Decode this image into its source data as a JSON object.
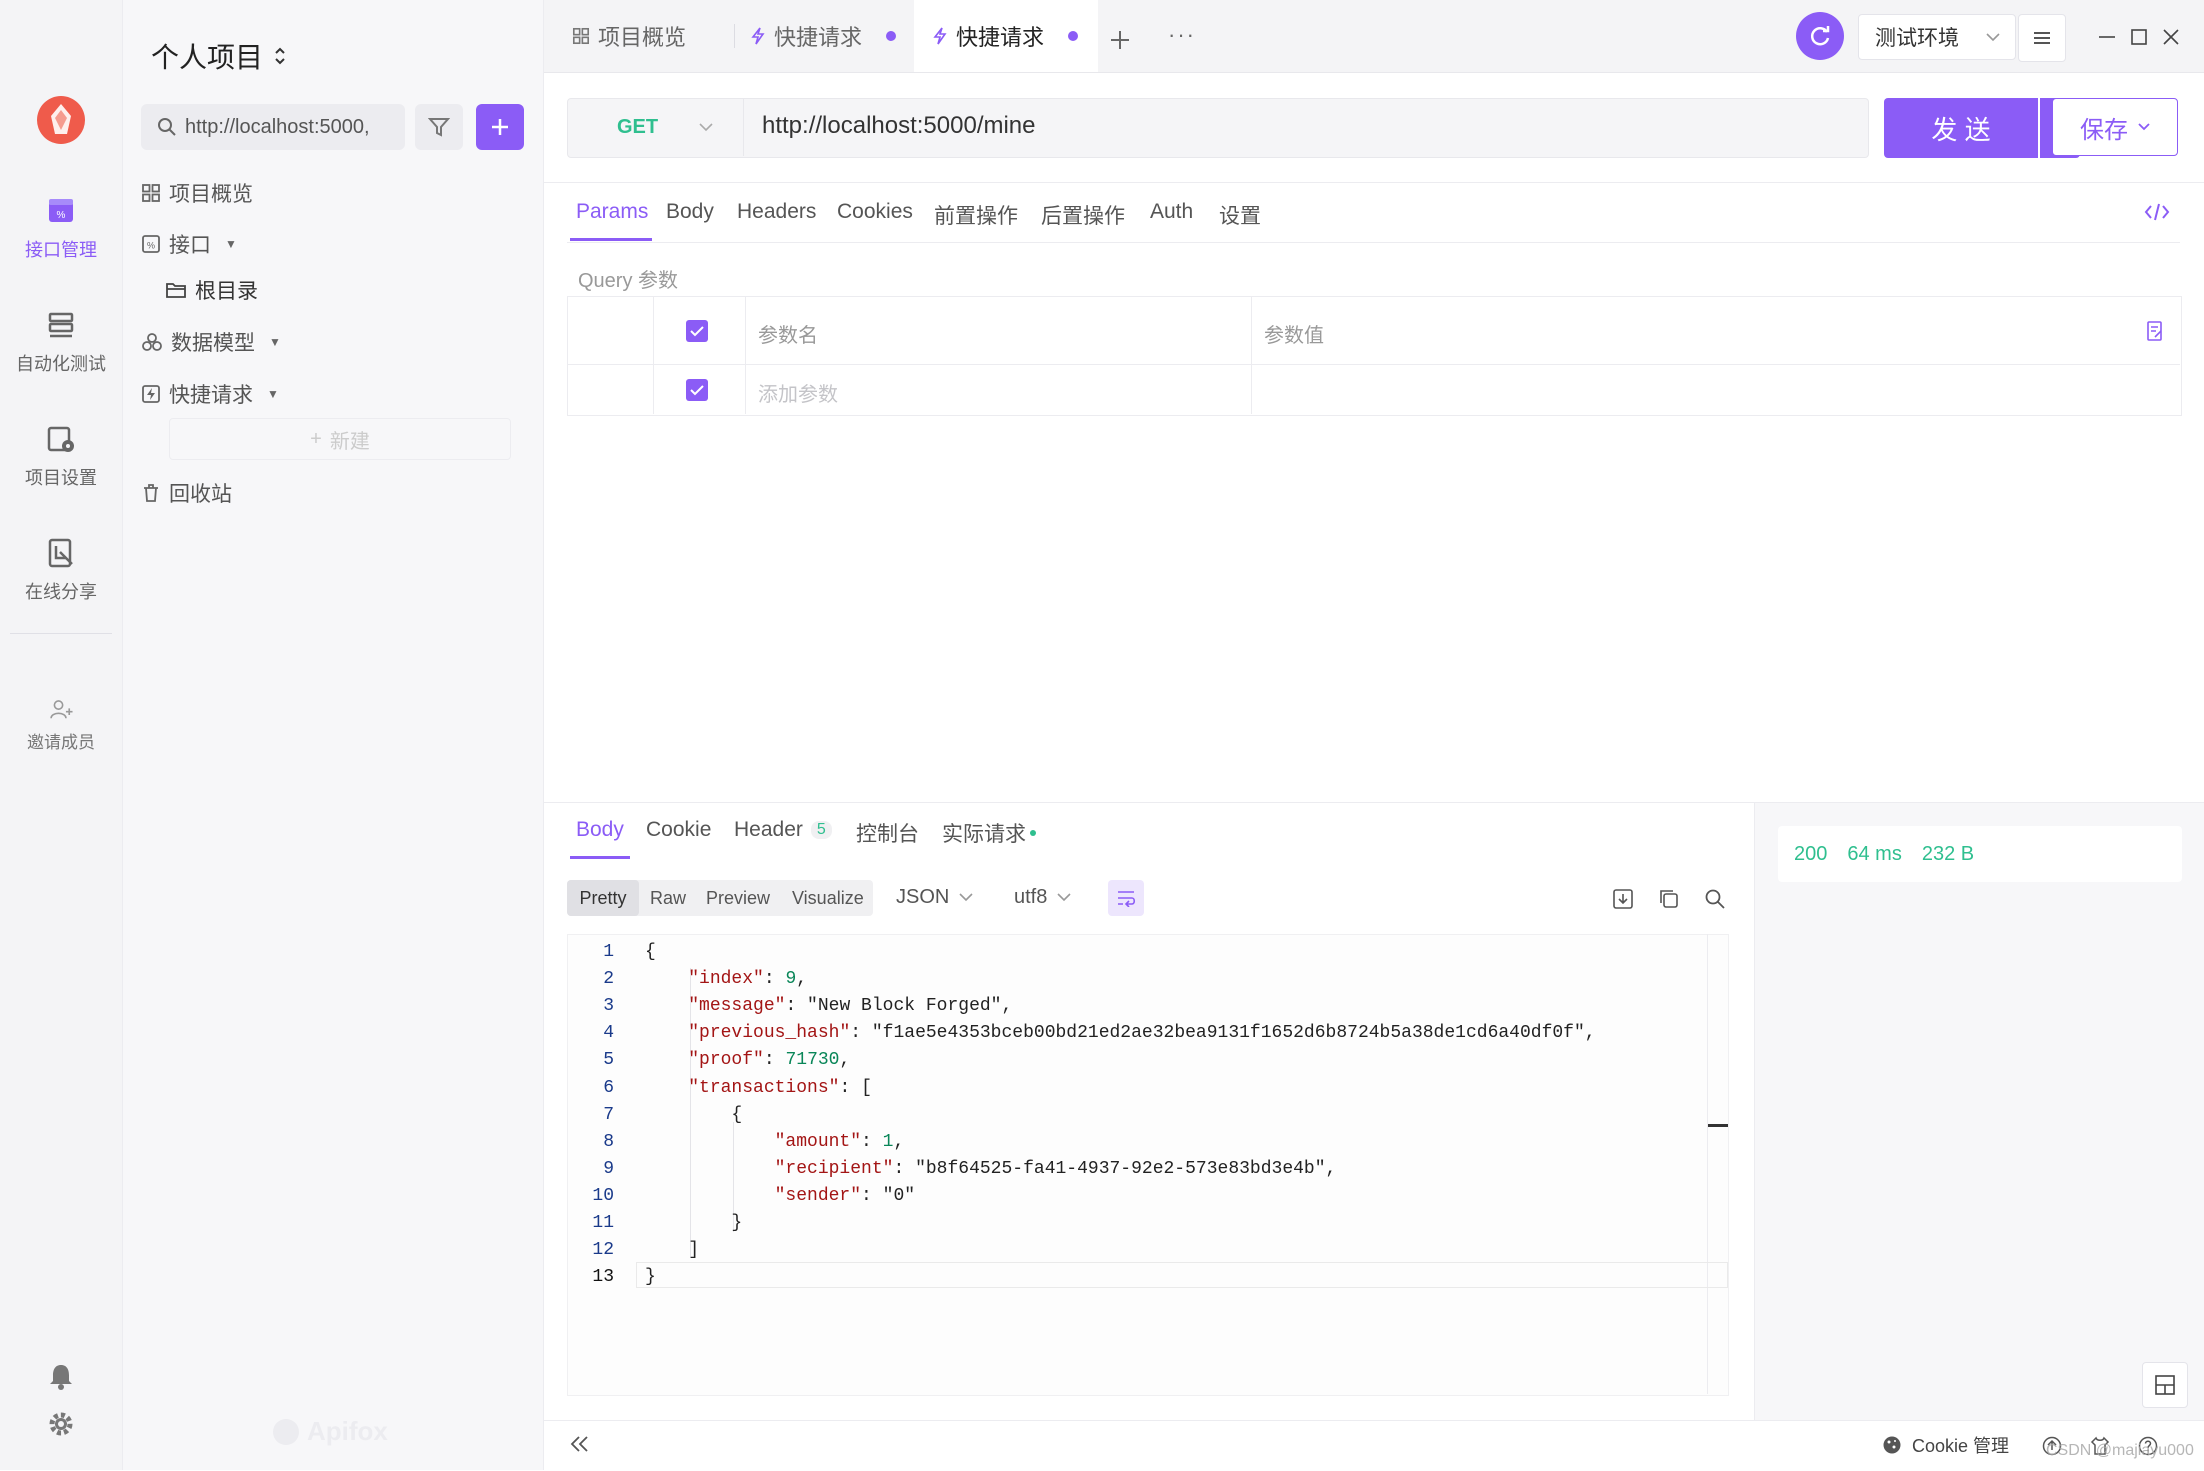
{
  "rail": {
    "items": [
      {
        "label": "接口管理",
        "active": true,
        "icon": "api-icon"
      },
      {
        "label": "自动化测试",
        "icon": "automation-icon"
      },
      {
        "label": "项目设置",
        "icon": "project-settings-icon"
      },
      {
        "label": "在线分享",
        "icon": "share-icon"
      },
      {
        "label": "邀请成员",
        "icon": "invite-member-icon"
      }
    ]
  },
  "sidebar": {
    "project_title": "个人项目",
    "search_placeholder": "http://localhost:5000,",
    "tree": {
      "overview": "项目概览",
      "interfaces": "接口",
      "root": "根目录",
      "models": "数据模型",
      "quick": "快捷请求",
      "new": "新建",
      "trash": "回收站"
    },
    "watermark": "Apifox"
  },
  "tabs": [
    {
      "label": "项目概览",
      "icon": "grid-icon"
    },
    {
      "label": "快捷请求",
      "icon": "bolt-icon",
      "dot": true
    },
    {
      "label": "快捷请求",
      "icon": "bolt-icon",
      "dot": true,
      "active": true
    }
  ],
  "header": {
    "env": "测试环境"
  },
  "request": {
    "method": "GET",
    "url": "http://localhost:5000/mine",
    "send": "发 送",
    "save": "保存"
  },
  "req_tabs": [
    "Params",
    "Body",
    "Headers",
    "Cookies",
    "前置操作",
    "后置操作",
    "Auth",
    "设置"
  ],
  "params": {
    "section": "Query 参数",
    "col_name": "参数名",
    "col_value": "参数值",
    "add_placeholder": "添加参数"
  },
  "resp_tabs": {
    "body": "Body",
    "cookie": "Cookie",
    "header": "Header",
    "header_count": "5",
    "console": "控制台",
    "actual": "实际请求"
  },
  "view_modes": [
    "Pretty",
    "Raw",
    "Preview",
    "Visualize"
  ],
  "format": "JSON",
  "encoding": "utf8",
  "status": {
    "code": "200",
    "time": "64 ms",
    "size": "232 B"
  },
  "code_lines": [
    "{",
    "    \"index\": 9,",
    "    \"message\": \"New Block Forged\",",
    "    \"previous_hash\": \"f1ae5e4353bceb00bd21ed2ae32bea9131f1652d6b8724b5a38de1cd6a40df0f\",",
    "    \"proof\": 71730,",
    "    \"transactions\": [",
    "        {",
    "            \"amount\": 1,",
    "            \"recipient\": \"b8f64525-fa41-4937-92e2-573e83bd3e4b\",",
    "            \"sender\": \"0\"",
    "        }",
    "    ]",
    "}"
  ],
  "footer": {
    "cookie_manage": "Cookie 管理",
    "csdn": "CSDN @majiayu000"
  },
  "colors": {
    "accent": "#8b5cf6",
    "method": "#2fbf8f",
    "status": "#2fbf8f"
  }
}
